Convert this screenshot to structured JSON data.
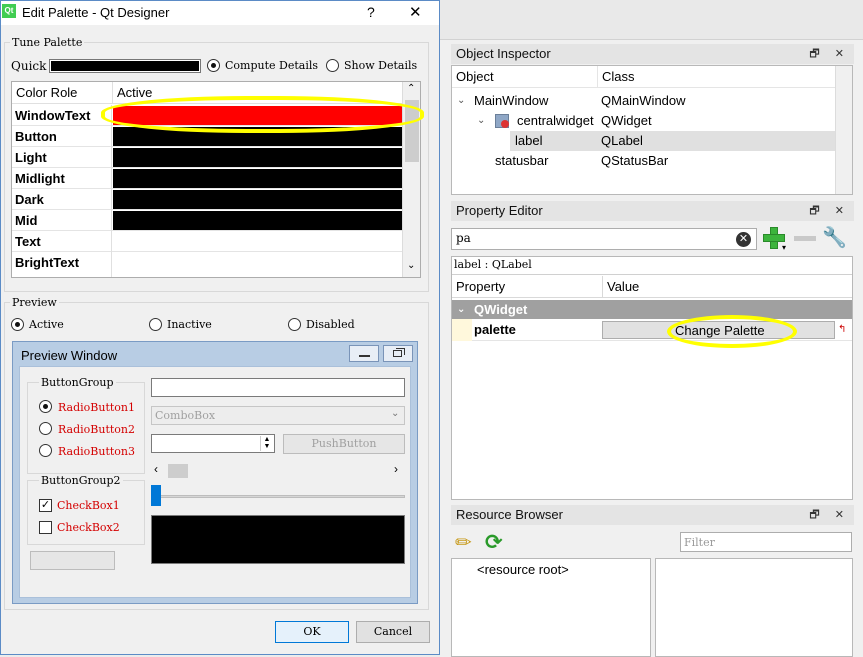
{
  "dialog": {
    "title": "Edit Palette - Qt Designer",
    "app_icon": "Qt",
    "help_glyph": "?",
    "close_glyph": "✕",
    "tune_palette": {
      "label": "Tune Palette",
      "quick_label": "Quick",
      "quick_color": "#000000",
      "compute_details": "Compute Details",
      "show_details": "Show Details",
      "selected_mode": "Compute Details"
    },
    "color_table": {
      "headers": [
        "Color Role",
        "Active"
      ],
      "rows": [
        {
          "role": "WindowText",
          "color": "#ff0000"
        },
        {
          "role": "Button",
          "color": "#000000"
        },
        {
          "role": "Light",
          "color": "#000000"
        },
        {
          "role": "Midlight",
          "color": "#000000"
        },
        {
          "role": "Dark",
          "color": "#000000"
        },
        {
          "role": "Mid",
          "color": "#000000"
        },
        {
          "role": "Text",
          "color": "#ffffff"
        },
        {
          "role": "BrightText",
          "color": "#ffffff"
        }
      ]
    },
    "preview": {
      "label": "Preview",
      "active": "Active",
      "inactive": "Inactive",
      "disabled": "Disabled",
      "selected": "Active",
      "window_title": "Preview Window",
      "button_group": "ButtonGroup",
      "radio1": "RadioButton1",
      "radio2": "RadioButton2",
      "radio3": "RadioButton3",
      "button_group2": "ButtonGroup2",
      "check1": "CheckBox1",
      "check2": "CheckBox2",
      "combo_box": "ComboBox",
      "push_button": "PushButton"
    },
    "ok": "OK",
    "cancel": "Cancel"
  },
  "object_inspector": {
    "title": "Object Inspector",
    "headers": [
      "Object",
      "Class"
    ],
    "rows": [
      {
        "object": "MainWindow",
        "class": "QMainWindow"
      },
      {
        "object": "centralwidget",
        "class": "QWidget"
      },
      {
        "object": "label",
        "class": "QLabel"
      },
      {
        "object": "statusbar",
        "class": "QStatusBar"
      }
    ]
  },
  "property_editor": {
    "title": "Property Editor",
    "filter_value": "pa",
    "object_label": "label : QLabel",
    "headers": [
      "Property",
      "Value"
    ],
    "section": "QWidget",
    "property_name": "palette",
    "change_palette": "Change Palette"
  },
  "resource_browser": {
    "title": "Resource Browser",
    "filter_placeholder": "Filter",
    "root": "<resource root>"
  },
  "dock_buttons": "🗗 ✕",
  "colors": {
    "highlight_yellow": "#ffff00",
    "section_header": "#a0a0a0",
    "dialog_border": "#5b8bc6"
  }
}
